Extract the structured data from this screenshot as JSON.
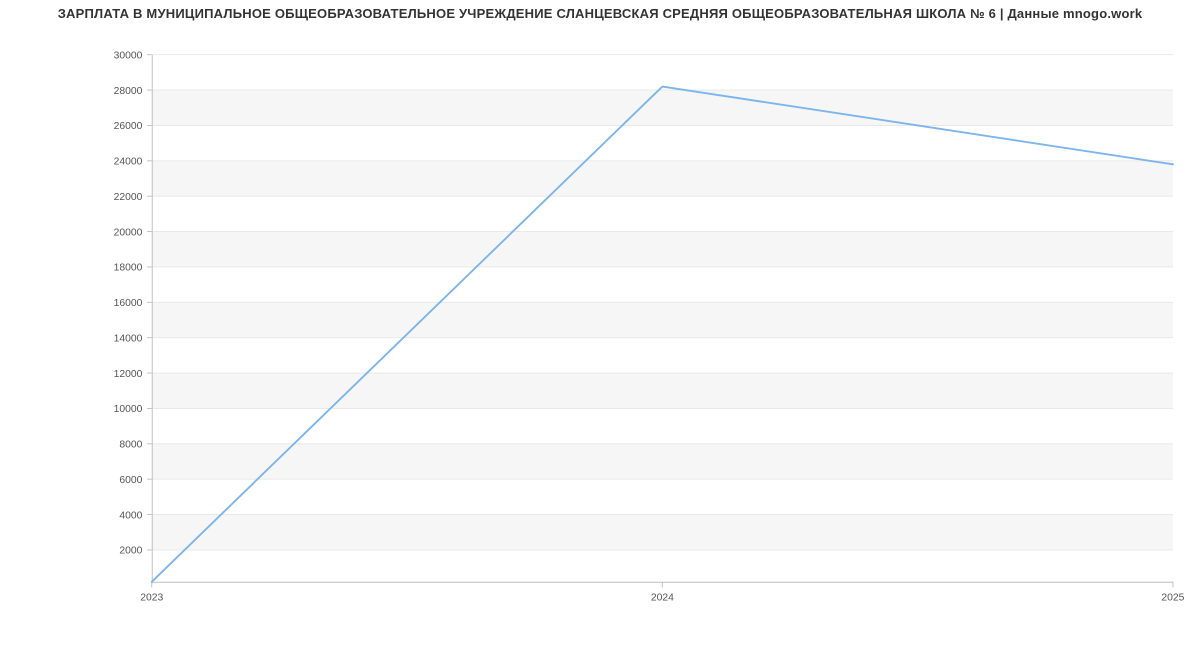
{
  "chart_data": {
    "type": "line",
    "title": "ЗАРПЛАТА В МУНИЦИПАЛЬНОЕ ОБЩЕОБРАЗОВАТЕЛЬНОЕ УЧРЕЖДЕНИЕ СЛАНЦЕВСКАЯ СРЕДНЯЯ ОБЩЕОБРАЗОВАТЕЛЬНАЯ ШКОЛА № 6 | Данные mnogo.work",
    "xlabel": "",
    "ylabel": "",
    "x_categories": [
      "2023",
      "2024",
      "2025"
    ],
    "y_ticks": [
      2000,
      4000,
      6000,
      8000,
      10000,
      12000,
      14000,
      16000,
      18000,
      20000,
      22000,
      24000,
      26000,
      28000,
      30000
    ],
    "ylim": [
      200,
      30000
    ],
    "series": [
      {
        "name": "Зарплата",
        "color": "#7cb5ec",
        "values": [
          200,
          28200,
          23800
        ]
      }
    ],
    "grid": true
  }
}
